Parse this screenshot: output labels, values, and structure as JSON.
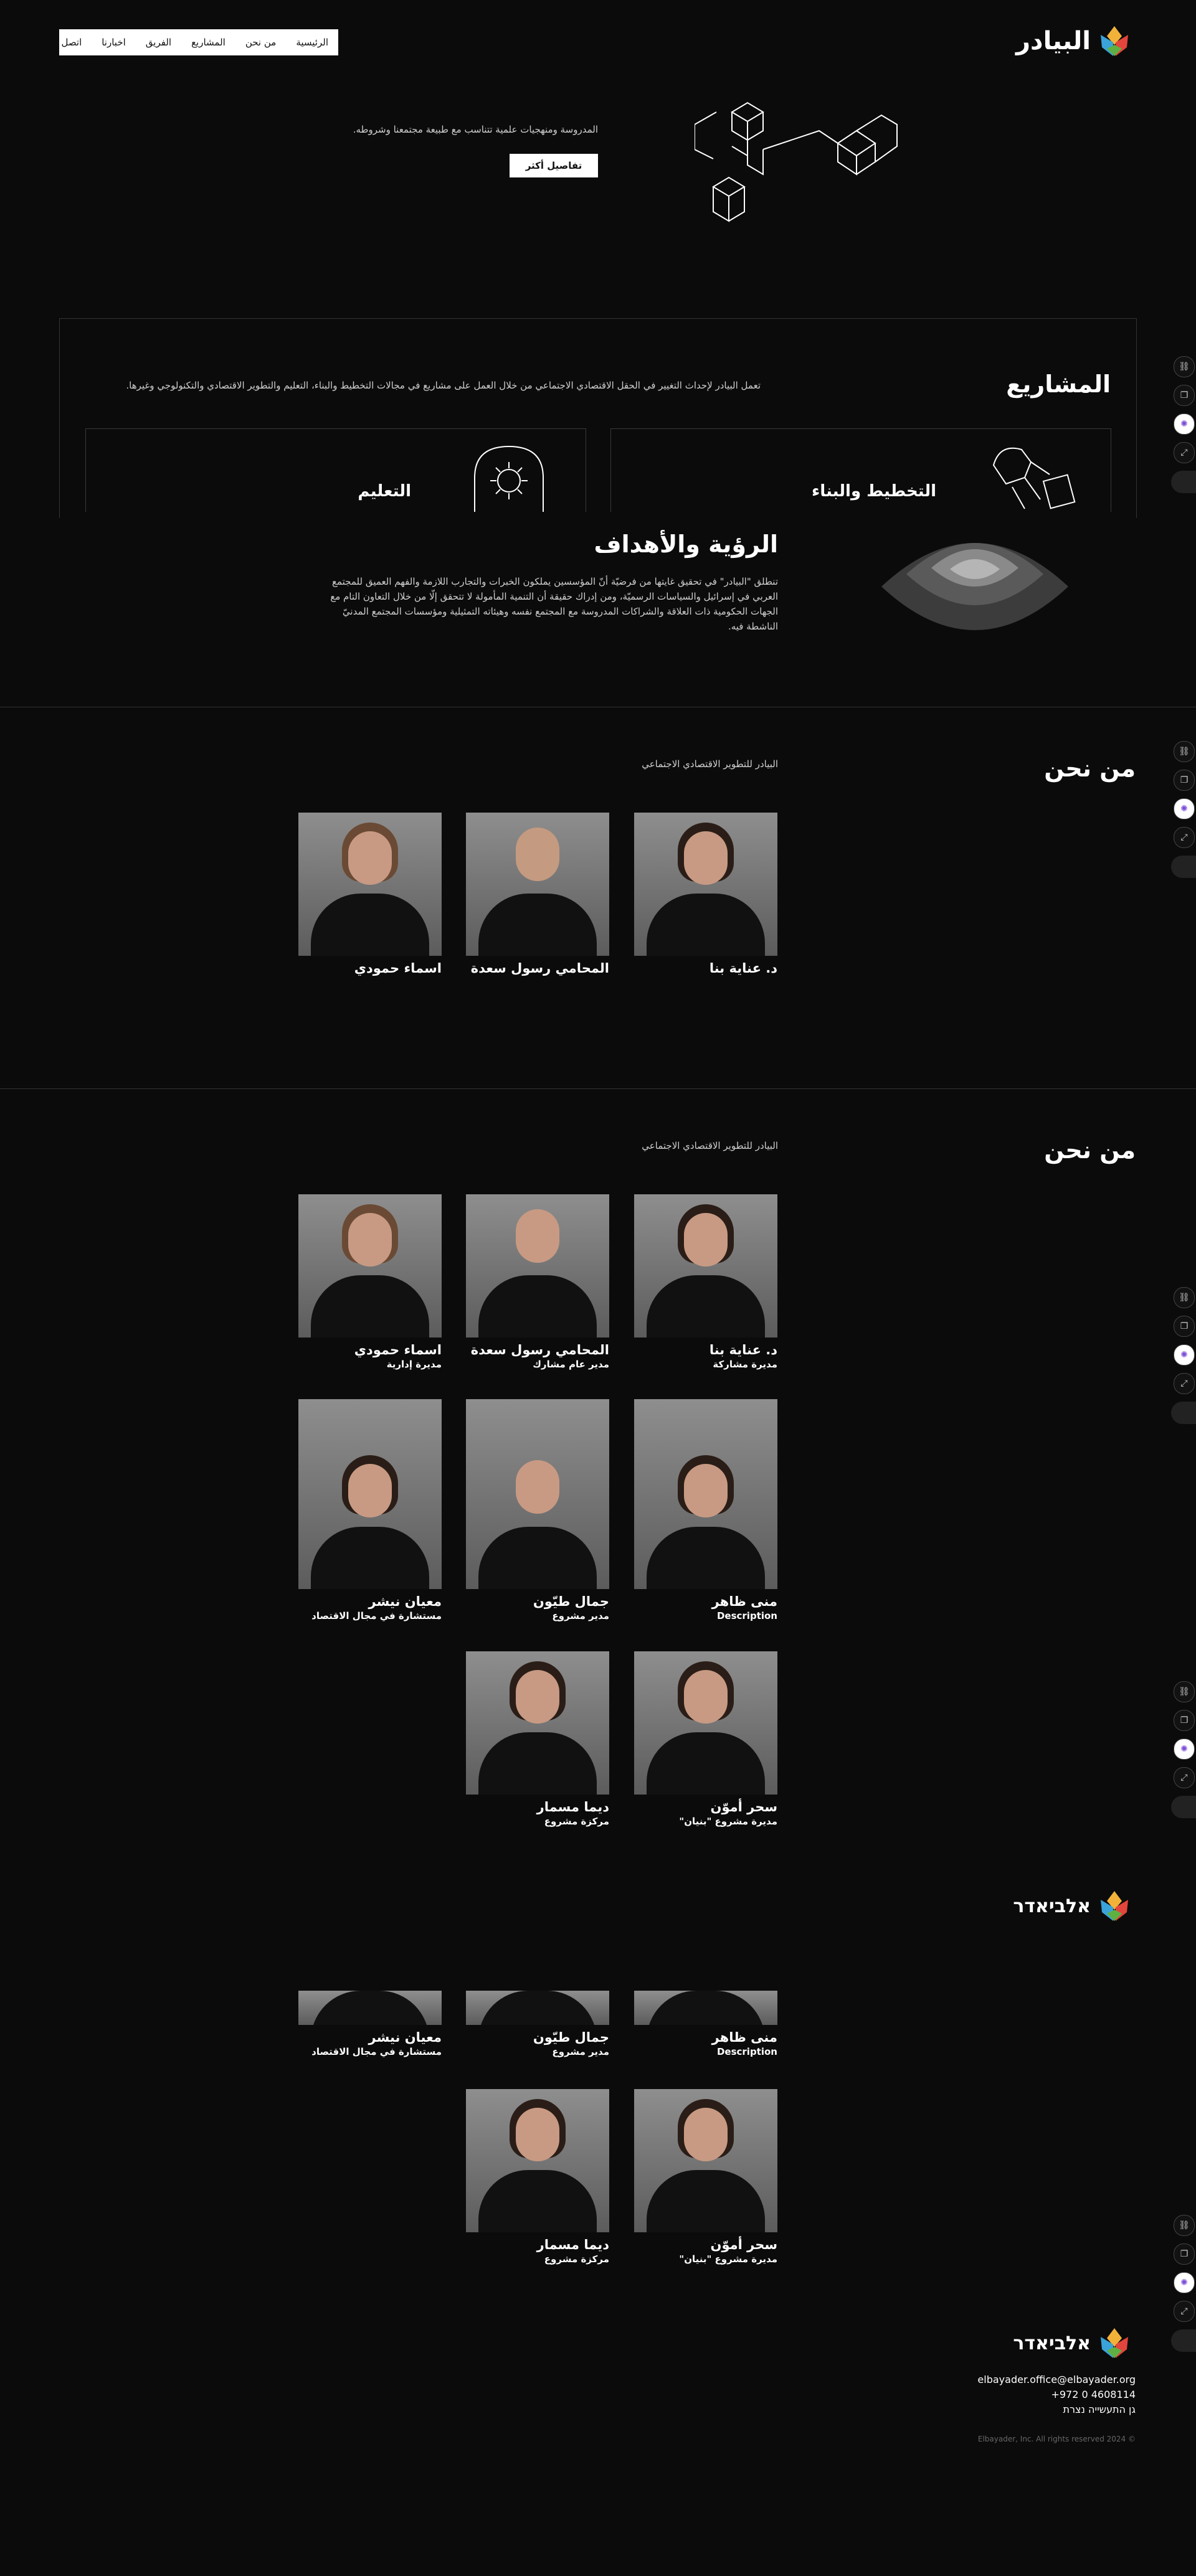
{
  "nav": {
    "items": [
      "اتصل بنا",
      "اخبارنا",
      "الفريق",
      "المشاريع",
      "من نحن",
      "الرئيسية"
    ]
  },
  "brand": {
    "name": "البيادر",
    "name_he": "אלביאדר"
  },
  "hero": {
    "text": "المدروسة ومنهجيات علمية تتناسب مع طبيعة مجتمعنا وشروطه.",
    "button": "تفاصيل أكثر"
  },
  "projects": {
    "title": "المشاريع",
    "desc": "تعمل البيادر لإحداث التغيير في الحقل الاقتصادي الاجتماعي من خلال العمل على مشاريع في مجالات التخطيط والبناء، التعليم والتطوير الاقتصادي والتكنولوجي وغيرها.",
    "cards": [
      "التخطيط والبناء",
      "التعليم"
    ]
  },
  "vision": {
    "title": "الرؤية والأهداف",
    "text": "تنطلق \"البيادر\" في تحقيق غايتها من فرضيّة أنّ المؤسسين يملكون الخبرات والتجارب اللازمة والفهم العميق للمجتمع العربي في إسرائيل والسياسات الرسميّة، ومن إدراك حقيقة أن التنمية المأمولة لا تتحقق إلّا من خلال التعاون التام مع الجهات الحكومية ذات العلاقة والشراكات المدروسة مع المجتمع نفسه وهيئاته التمثيلية ومؤسسات المجتمع المدنيّ الناشطة فيه."
  },
  "about1": {
    "title": "من نحن",
    "subtitle": "البيادر للتطوير الاقتصادي الاجتماعي",
    "people": [
      "د. عناية بنا",
      "المحامي رسول سعدة",
      "اسماء حمودي"
    ]
  },
  "about2": {
    "title": "من نحن",
    "subtitle": "البيادر للتطوير الاقتصادي الاجتماعي",
    "people": [
      {
        "name": "د. عناية بنا",
        "role": "مديرة مشاركة"
      },
      {
        "name": "المحامي رسول سعدة",
        "role": "مدير عام مشارك"
      },
      {
        "name": "اسماء حمودي",
        "role": "مديرة إدارية"
      },
      {
        "name": "منى ظاهر",
        "role": "Description"
      },
      {
        "name": "جمال طيّون",
        "role": "مدير مشروع"
      },
      {
        "name": "معيان نيشر",
        "role": "مستشارة في مجال الاقتصاد"
      },
      {
        "name": "سحر أموّن",
        "role": "مديرة مشروع \"بنيان\""
      },
      {
        "name": "ديما مسمار",
        "role": "مركزة مشروع"
      }
    ]
  },
  "footer": {
    "email": "elbayader.office@elbayader.org",
    "phone": "+972 0 4608114",
    "address": "גן התעשייה נצרת",
    "copyright": "Elbayader, Inc. All rights reserved 2024 ©"
  },
  "side_icons": [
    "link-icon",
    "copy-icon",
    "ai-icon",
    "expand-icon",
    "pill"
  ]
}
